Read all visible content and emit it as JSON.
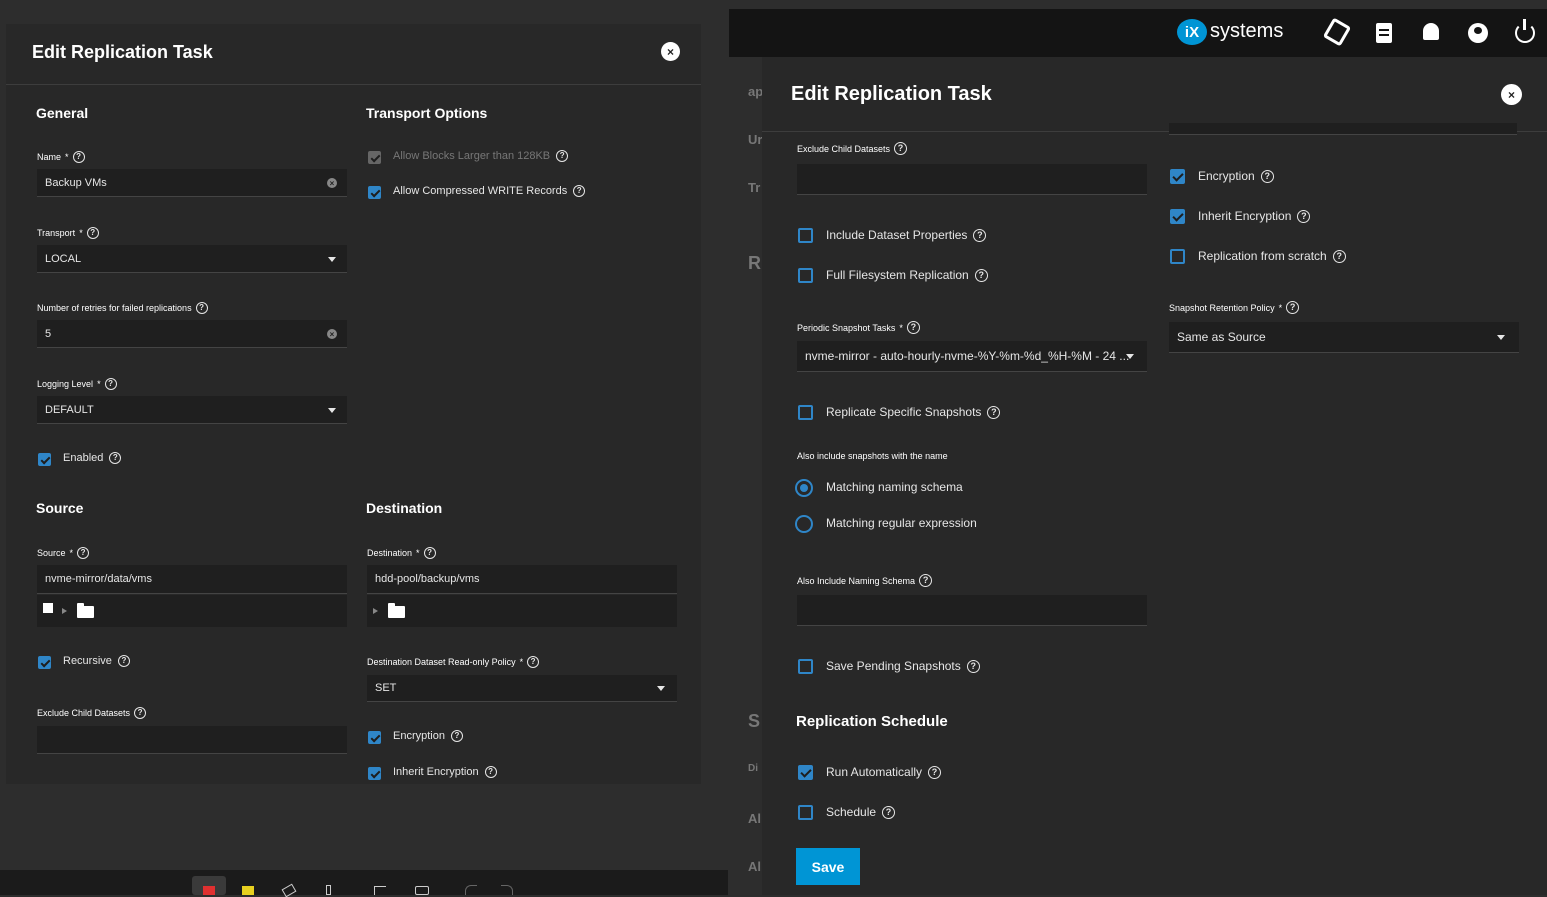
{
  "left": {
    "title": "Edit Replication Task",
    "general": {
      "heading": "General",
      "name_label": "Name",
      "name_value": "Backup VMs",
      "transport_label": "Transport",
      "transport_value": "LOCAL",
      "retries_label": "Number of retries for failed replications",
      "retries_value": "5",
      "logging_label": "Logging Level",
      "logging_value": "DEFAULT",
      "enabled_label": "Enabled"
    },
    "transport_options": {
      "heading": "Transport Options",
      "large_blocks_label": "Allow Blocks Larger than 128KB",
      "compressed_label": "Allow Compressed WRITE Records"
    },
    "source": {
      "heading": "Source",
      "source_label": "Source",
      "source_value": "nvme-mirror/data/vms",
      "recursive_label": "Recursive",
      "exclude_label": "Exclude Child Datasets"
    },
    "destination": {
      "heading": "Destination",
      "dest_label": "Destination",
      "dest_value": "hdd-pool/backup/vms",
      "readonly_label": "Destination Dataset Read-only Policy",
      "readonly_value": "SET",
      "encryption_label": "Encryption",
      "inherit_label": "Inherit Encryption"
    },
    "toolbar_icons": [
      "marker-icon",
      "highlighter-icon",
      "eraser-icon",
      "pen-icon",
      "crop-icon",
      "text-icon",
      "undo-icon",
      "redo-icon"
    ]
  },
  "right": {
    "brand": "systems",
    "brand_mark": "iX",
    "title": "Edit Replication Task",
    "bg_fragments": [
      "ap",
      "Ur",
      "Tr",
      "R",
      "S",
      "Di",
      "Al",
      "Al"
    ],
    "exclude_label": "Exclude Child Datasets",
    "include_props_label": "Include Dataset Properties",
    "full_fs_label": "Full Filesystem Replication",
    "periodic_label": "Periodic Snapshot Tasks",
    "periodic_value": "nvme-mirror - auto-hourly-nvme-%Y-%m-%d_%H-%M - 24 ...",
    "replicate_specific_label": "Replicate Specific Snapshots",
    "also_include_heading": "Also include snapshots with the name",
    "radio_naming": "Matching naming schema",
    "radio_regex": "Matching regular expression",
    "naming_schema_label": "Also Include Naming Schema",
    "save_pending_label": "Save Pending Snapshots",
    "schedule_heading": "Replication Schedule",
    "run_auto_label": "Run Automatically",
    "schedule_label": "Schedule",
    "encryption_label": "Encryption",
    "inherit_label": "Inherit Encryption",
    "scratch_label": "Replication from scratch",
    "retention_label": "Snapshot Retention Policy",
    "retention_value": "Same as Source",
    "save_label": "Save"
  },
  "required_mark": "*",
  "help_glyph": "?",
  "clear_glyph": "×",
  "colors": {
    "accent": "#2f86c8",
    "save": "#0095d5",
    "panel": "#282828",
    "header": "#141414"
  }
}
